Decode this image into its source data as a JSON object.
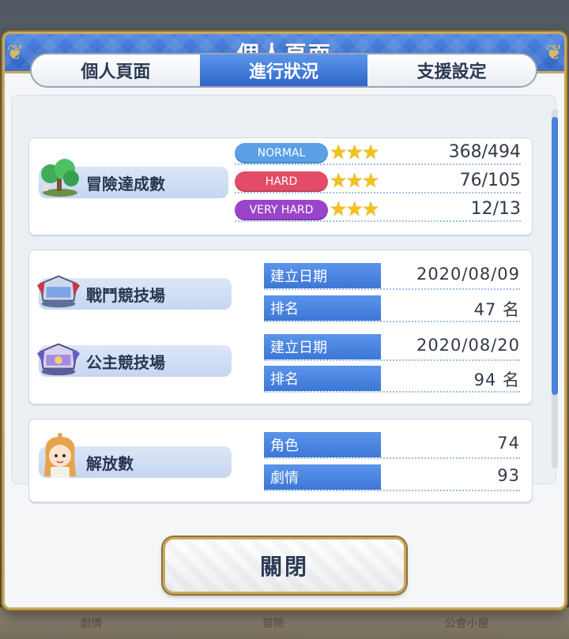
{
  "dialog": {
    "title": "個人頁面",
    "close_label": "關閉"
  },
  "tabs": [
    {
      "label": "個人頁面",
      "active": false
    },
    {
      "label": "進行狀況",
      "active": true
    },
    {
      "label": "支援設定",
      "active": false
    }
  ],
  "adventure": {
    "label": "冒險達成數",
    "icon": "forest-tree-icon",
    "rows": [
      {
        "difficulty": "NORMAL",
        "color": "#5aa0e6",
        "stars": "★★★",
        "value": "368/494"
      },
      {
        "difficulty": "HARD",
        "color": "#e24c66",
        "stars": "★★★",
        "value": "76/105"
      },
      {
        "difficulty": "VERY HARD",
        "color": "#9a45c9",
        "stars": "★★★",
        "value": "12/13"
      }
    ]
  },
  "arena": {
    "battle": {
      "label": "戰鬥競技場",
      "icon": "battle-arena-icon",
      "created_label": "建立日期",
      "created_value": "2020/08/09",
      "rank_label": "排名",
      "rank_value": "47 名"
    },
    "princess": {
      "label": "公主競技場",
      "icon": "princess-arena-icon",
      "created_label": "建立日期",
      "created_value": "2020/08/20",
      "rank_label": "排名",
      "rank_value": "94 名"
    }
  },
  "unlocks": {
    "label": "解放數",
    "icon": "character-portrait-icon",
    "character_label": "角色",
    "character_value": "74",
    "story_label": "劇情",
    "story_value": "93"
  },
  "background_nav": [
    "劇情",
    "冒險",
    "公會小屋"
  ]
}
